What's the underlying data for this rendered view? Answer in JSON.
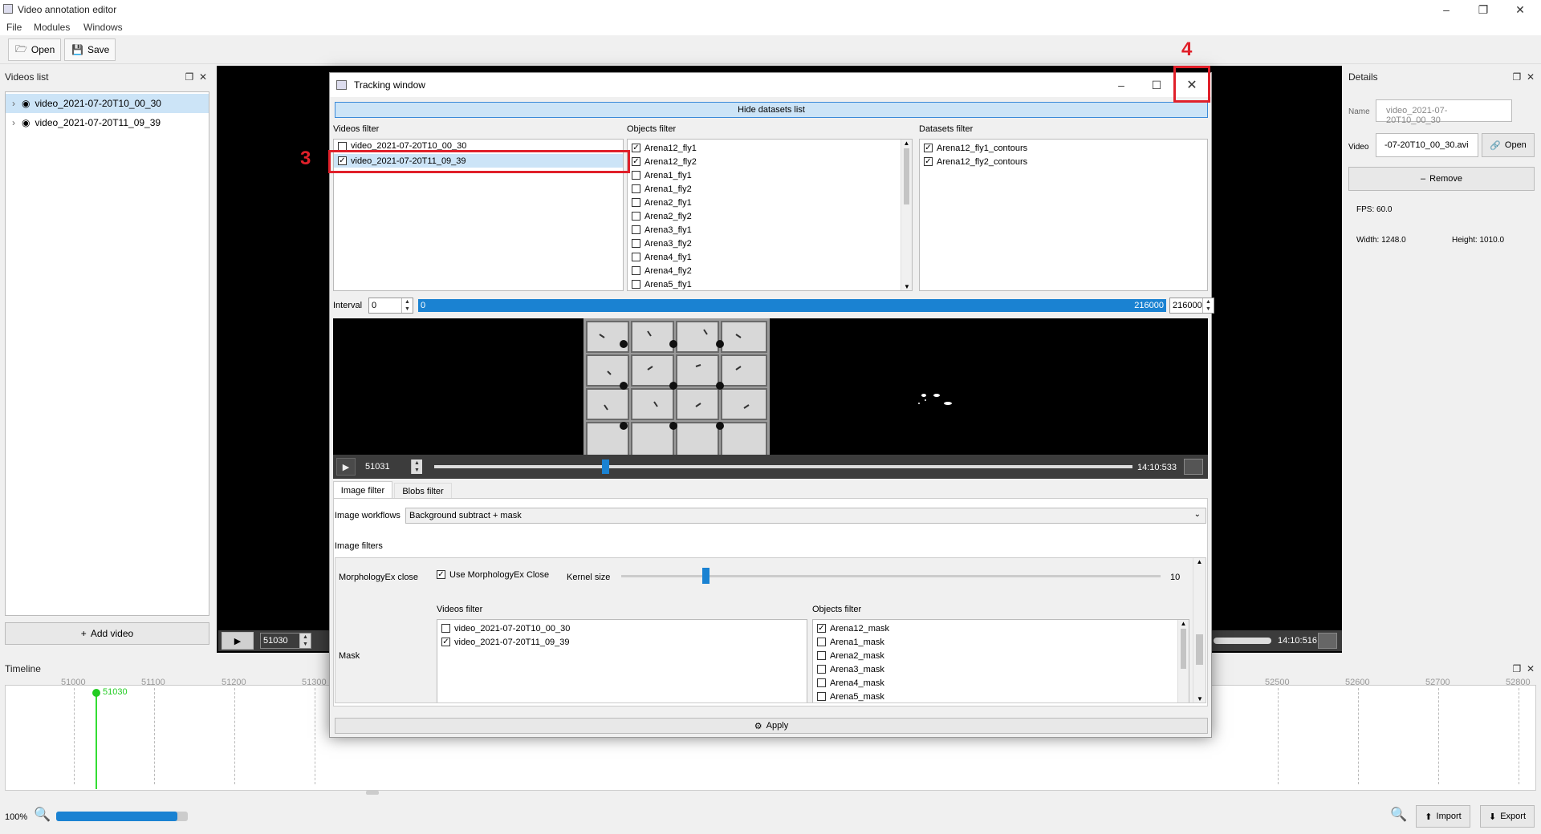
{
  "app": {
    "title": "Video annotation editor"
  },
  "menu": [
    "File",
    "Modules",
    "Windows"
  ],
  "toolbar": {
    "open": "Open",
    "save": "Save"
  },
  "videos_panel": {
    "title": "Videos list",
    "items": [
      "video_2021-07-20T10_00_30",
      "video_2021-07-20T11_09_39"
    ],
    "add_button": "Add video"
  },
  "details": {
    "title": "Details",
    "name_label": "Name",
    "name_value": "video_2021-07-20T10_00_30",
    "video_label": "Video",
    "video_value": "-07-20T10_00_30.avi",
    "open_button": "Open",
    "remove_button": "Remove",
    "fps": "FPS: 60.0",
    "width": "Width: 1248.0",
    "height": "Height: 1010.0"
  },
  "main_player": {
    "frame": "51030",
    "time": "14:10:516"
  },
  "timeline": {
    "title": "Timeline",
    "current": "51030",
    "ticks": [
      "51000",
      "51100",
      "51200",
      "51300",
      "52500",
      "52600",
      "52700",
      "52800"
    ]
  },
  "statusbar": {
    "zoom": "100%",
    "zoom_fill": 0.92,
    "import": "Import",
    "export": "Export"
  },
  "tracking": {
    "title": "Tracking window",
    "hide_datasets": "Hide datasets list",
    "videos_filter_label": "Videos filter",
    "videos": [
      {
        "name": "video_2021-07-20T10_00_30",
        "checked": false
      },
      {
        "name": "video_2021-07-20T11_09_39",
        "checked": true
      }
    ],
    "objects_filter_label": "Objects filter",
    "objects": [
      {
        "name": "Arena12_fly1",
        "checked": true
      },
      {
        "name": "Arena12_fly2",
        "checked": true
      },
      {
        "name": "Arena1_fly1",
        "checked": false
      },
      {
        "name": "Arena1_fly2",
        "checked": false
      },
      {
        "name": "Arena2_fly1",
        "checked": false
      },
      {
        "name": "Arena2_fly2",
        "checked": false
      },
      {
        "name": "Arena3_fly1",
        "checked": false
      },
      {
        "name": "Arena3_fly2",
        "checked": false
      },
      {
        "name": "Arena4_fly1",
        "checked": false
      },
      {
        "name": "Arena4_fly2",
        "checked": false
      },
      {
        "name": "Arena5_fly1",
        "checked": false
      }
    ],
    "datasets_filter_label": "Datasets filter",
    "datasets": [
      {
        "name": "Arena12_fly1_contours",
        "checked": true
      },
      {
        "name": "Arena12_fly2_contours",
        "checked": true
      }
    ],
    "interval_label": "Interval",
    "interval_start": "0",
    "interval_bar_start": "0",
    "interval_bar_end": "216000",
    "interval_end": "216000",
    "player_frame": "51031",
    "player_time": "14:10:533",
    "player_progress": 0.24,
    "tabs": [
      "Image filter",
      "Blobs filter"
    ],
    "workflows_label": "Image workflows",
    "workflow_value": "Background subtract + mask",
    "image_filters_label": "Image filters",
    "morph_label": "MorphologyEx close",
    "morph_use": "Use MorphologyEx Close",
    "kernel_label": "Kernel size",
    "kernel_value": "10",
    "kernel_level": 0.15,
    "mask_label": "Mask",
    "mask_videos_label": "Videos filter",
    "mask_videos": [
      {
        "name": "video_2021-07-20T10_00_30",
        "checked": false
      },
      {
        "name": "video_2021-07-20T11_09_39",
        "checked": true
      }
    ],
    "mask_objects_label": "Objects filter",
    "mask_objects": [
      {
        "name": "Arena12_mask",
        "checked": true
      },
      {
        "name": "Arena1_mask",
        "checked": false
      },
      {
        "name": "Arena2_mask",
        "checked": false
      },
      {
        "name": "Arena3_mask",
        "checked": false
      },
      {
        "name": "Arena4_mask",
        "checked": false
      },
      {
        "name": "Arena5_mask",
        "checked": false
      }
    ],
    "apply": "Apply"
  },
  "annotations": {
    "step3": "3",
    "step4": "4",
    "color": "#e0202a"
  }
}
